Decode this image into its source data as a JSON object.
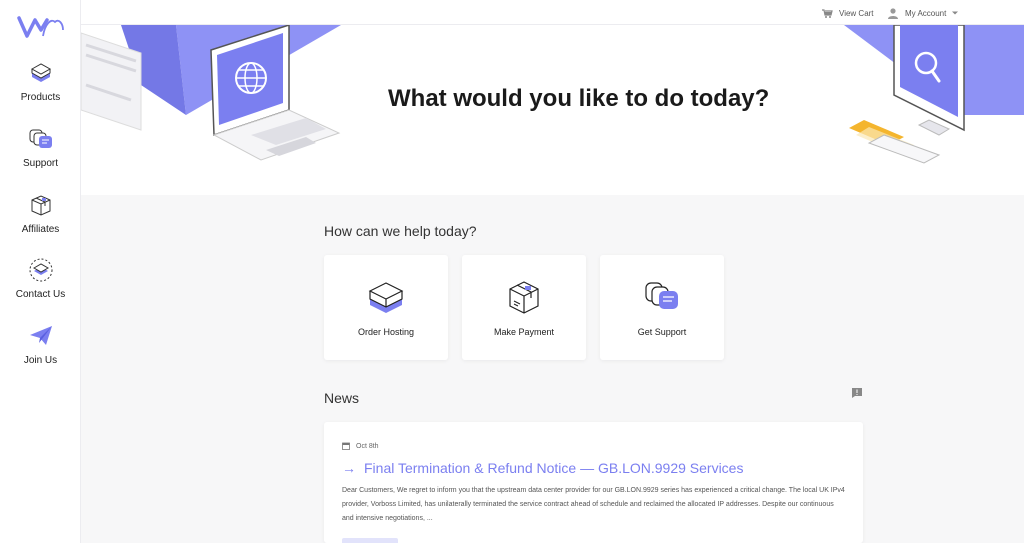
{
  "sidebar": {
    "items": [
      {
        "label": "Products",
        "icon": "box-icon"
      },
      {
        "label": "Support",
        "icon": "chat-bubbles-icon"
      },
      {
        "label": "Affiliates",
        "icon": "package-icon"
      },
      {
        "label": "Contact Us",
        "icon": "layers-icon"
      },
      {
        "label": "Join Us",
        "icon": "paper-plane-icon"
      }
    ]
  },
  "topbar": {
    "view_cart": "View Cart",
    "my_account": "My Account"
  },
  "hero": {
    "title": "What would you like to do today?"
  },
  "help": {
    "heading": "How can we help today?",
    "cards": [
      {
        "label": "Order Hosting",
        "icon": "box-icon"
      },
      {
        "label": "Make Payment",
        "icon": "package-icon"
      },
      {
        "label": "Get Support",
        "icon": "chat-bubbles-icon"
      }
    ]
  },
  "news": {
    "heading": "News",
    "items": [
      {
        "date": "Oct 8th",
        "title": "Final Termination & Refund Notice — GB.LON.9929 Services",
        "body": "Dear Customers, We regret to inform you that the upstream data center provider for our GB.LON.9929 series has experienced a critical change. The local UK IPv4 provider, Vorboss Limited, has unilaterally terminated the service contract ahead of schedule and reclaimed the allocated IP addresses. Despite our continuous and intensive negotiations, ..."
      }
    ]
  },
  "colors": {
    "accent": "#7b7ff0",
    "accent_dark": "#5a5fe0",
    "accent_light": "#8e92f5"
  }
}
